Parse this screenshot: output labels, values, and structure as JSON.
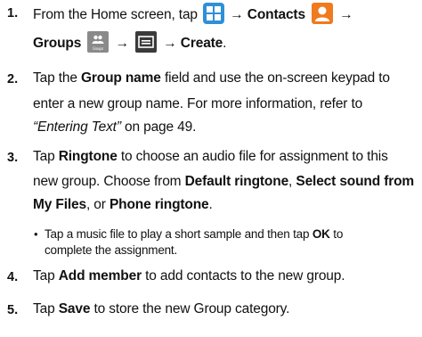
{
  "steps": [
    {
      "num": "1.",
      "l1_a": "From the Home screen, tap",
      "arrow1": "→",
      "contacts": "Contacts",
      "arrow2": "→",
      "groups": "Groups",
      "groups_icon_label": "Groups",
      "arrow3": "→",
      "arrow4": "→",
      "create": "Create",
      "period": "."
    },
    {
      "num": "2.",
      "a": "Tap the",
      "b": "Group name",
      "c": "field and use the on-screen keypad to",
      "d": "enter a new group name. For more information, refer to",
      "e": "“Entering Text”",
      "f": "on page 49."
    },
    {
      "num": "3.",
      "a": "Tap",
      "b": "Ringtone",
      "c": "to choose an audio file for assignment to this",
      "d": "new group. Choose from",
      "e": "Default ringtone",
      "f": ",",
      "g": "Select sound from",
      "h": "My Files",
      "i": ", or",
      "j": "Phone ringtone",
      "k": "."
    },
    {
      "bullet": "•",
      "a": "Tap a music file to play a short sample and then tap",
      "b": "OK",
      "c": "to",
      "d": "complete the assignment."
    },
    {
      "num": "4.",
      "a": "Tap",
      "b": "Add member",
      "c": "to add contacts to the new group."
    },
    {
      "num": "5.",
      "a": "Tap",
      "b": "Save",
      "c": "to store the new Group category."
    }
  ],
  "colors": {
    "apps_icon": "#2f8fd8",
    "contacts_icon": "#f07a1e",
    "groups_icon": "#8a8a8a",
    "menu_icon": "#3a3a3a"
  }
}
